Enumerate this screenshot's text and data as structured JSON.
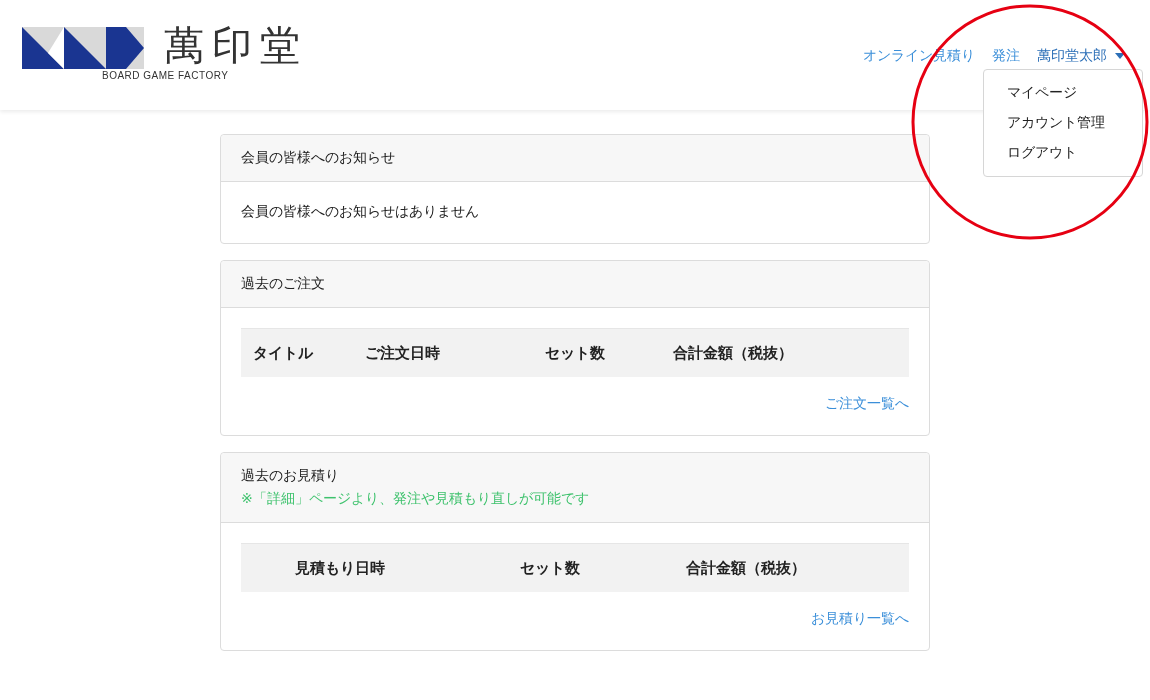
{
  "header": {
    "logo": {
      "name": "萬印堂",
      "tagline": "BOARD GAME FACTORY"
    },
    "nav": [
      {
        "label": "オンライン見積り"
      },
      {
        "label": "発注"
      }
    ],
    "user_menu": {
      "label": "萬印堂太郎",
      "expanded": true,
      "items": [
        {
          "label": "マイページ"
        },
        {
          "label": "アカウント管理"
        },
        {
          "label": "ログアウト"
        }
      ]
    }
  },
  "annotation": {
    "kind": "circle",
    "color": "#e60012"
  },
  "panels": [
    {
      "title": "会員の皆様へのお知らせ",
      "body": "会員の皆様へのお知らせはありません"
    },
    {
      "title": "過去のご注文",
      "columns": [
        "タイトル",
        "ご注文日時",
        "セット数",
        "合計金額（税抜）"
      ],
      "link": "ご注文一覧へ"
    },
    {
      "title": "過去のお見積り",
      "note": "※「詳細」ページより、発注や見積もり直しが可能です",
      "columns": [
        "見積もり日時",
        "セット数",
        "合計金額（税抜）"
      ],
      "link": "お見積り一覧へ"
    }
  ]
}
